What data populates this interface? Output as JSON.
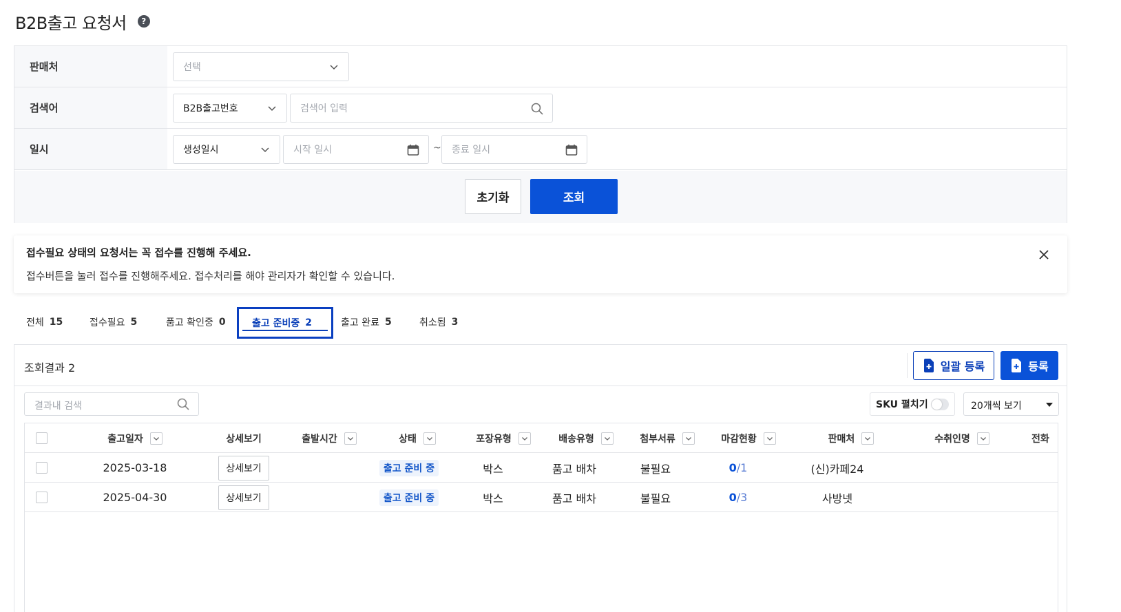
{
  "page": {
    "title": "B2B출고 요청서",
    "help_icon": "question-circle-icon"
  },
  "filter": {
    "seller_label": "판매처",
    "seller_placeholder": "선택",
    "keyword_label": "검색어",
    "keyword_type": "B2B출고번호",
    "keyword_placeholder": "검색어 입력",
    "date_label": "일시",
    "date_type": "생성일시",
    "start_placeholder": "시작 일시",
    "range_separator": "~",
    "end_placeholder": "종료 일시",
    "reset_label": "초기화",
    "search_label": "조회"
  },
  "notice": {
    "title": "접수필요 상태의 요청서는 꼭 접수를 진행해 주세요.",
    "message": "접수버튼을 눌러 접수를 진행해주세요. 접수처리를 해야 관리자가 확인할 수 있습니다."
  },
  "tabs": [
    {
      "label": "전체",
      "count": "15"
    },
    {
      "label": "접수필요",
      "count": "5"
    },
    {
      "label": "품고 확인중",
      "count": "0"
    },
    {
      "label": "출고 준비중",
      "count": "2",
      "active": true
    },
    {
      "label": "출고 완료",
      "count": "5"
    },
    {
      "label": "취소됨",
      "count": "3"
    }
  ],
  "results": {
    "count_text": "조회결과 2",
    "bulk_register_label": "일괄 등록",
    "register_label": "등록",
    "search_placeholder": "결과내 검색",
    "sku_toggle_label": "SKU 펼치기",
    "sku_toggle_on": false,
    "per_page": "20개씩 보기"
  },
  "table": {
    "columns": [
      "출고일자",
      "상세보기",
      "출발시간",
      "상태",
      "포장유형",
      "배송유형",
      "첨부서류",
      "마감현황",
      "판매처",
      "수취인명",
      "전화"
    ],
    "rows": [
      {
        "date": "2025-03-18",
        "detail": "상세보기",
        "depart_time": "",
        "status": "출고 준비 중",
        "packaging": "박스",
        "delivery": "품고 배차",
        "attachment": "불필요",
        "closing_done": "0",
        "closing_total": "/1",
        "seller": "(신)카페24",
        "recipient": "",
        "phone": ""
      },
      {
        "date": "2025-04-30",
        "detail": "상세보기",
        "depart_time": "",
        "status": "출고 준비 중",
        "packaging": "박스",
        "delivery": "품고 배차",
        "attachment": "불필요",
        "closing_done": "0",
        "closing_total": "/3",
        "seller": "사방넷",
        "recipient": "",
        "phone": ""
      }
    ]
  },
  "colors": {
    "primary": "#0a52d8",
    "active_tab": "#0a3fb8",
    "status_badge_bg": "#edf3fc",
    "status_badge_text": "#1457c9"
  }
}
